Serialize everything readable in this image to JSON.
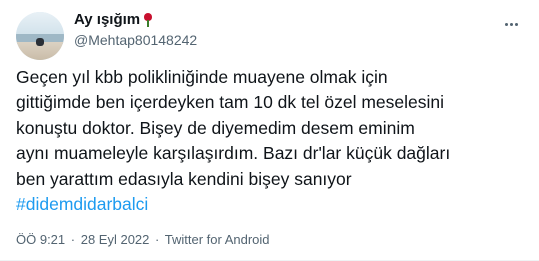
{
  "author": {
    "display_name": "Ay ışığım",
    "handle": "@Mehtap80148242",
    "avatar": "beach-photo-avatar",
    "name_emoji": "rose-icon"
  },
  "tweet": {
    "lines": [
      "Geçen yıl kbb polikliniğinde muayene olmak için",
      "gittiğimde ben içerdeyken tam 10 dk tel özel meselesini",
      "konuştu doktor. Bişey de diyemedim desem eminim",
      "aynı muameleyle karşılaşırdım. Bazı dr'lar küçük dağları",
      "ben yarattım edasıyla kendini bişey sanıyor"
    ],
    "hashtag": "#didemdidarbalci"
  },
  "meta": {
    "time": "ÖÖ 9:21",
    "separator1": "·",
    "date": "28 Eyl 2022",
    "separator2": "·",
    "source": "Twitter for Android"
  },
  "colors": {
    "text": "#0f1419",
    "secondary": "#536471",
    "link": "#1d9bf0"
  }
}
